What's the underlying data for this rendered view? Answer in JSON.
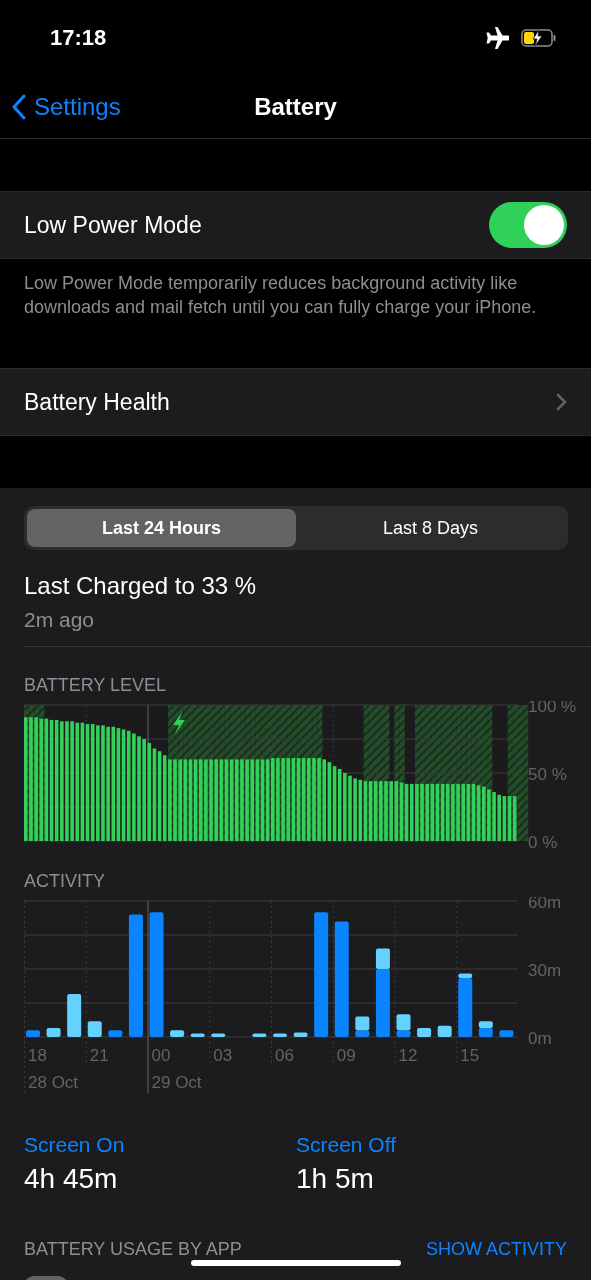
{
  "status_bar": {
    "time": "17:18",
    "airplane_mode": true,
    "charging": true
  },
  "nav": {
    "back": "Settings",
    "title": "Battery"
  },
  "low_power": {
    "label": "Low Power Mode",
    "on": true,
    "footer": "Low Power Mode temporarily reduces background activity like downloads and mail fetch until you can fully charge your iPhone."
  },
  "battery_health": {
    "label": "Battery Health"
  },
  "range_tabs": [
    {
      "label": "Last 24 Hours",
      "selected": true
    },
    {
      "label": "Last 8 Days",
      "selected": false
    }
  ],
  "last_charged": {
    "title": "Last Charged to 33 %",
    "time": "2m ago"
  },
  "battery_level": {
    "label": "BATTERY LEVEL",
    "chart_data": {
      "type": "bar",
      "ylim": [
        0,
        100
      ],
      "yticks": [
        {
          "value": 0,
          "label": "0 %"
        },
        {
          "value": 50,
          "label": "50 %"
        },
        {
          "value": 100,
          "label": "100 %"
        }
      ],
      "values": [
        91,
        91,
        91,
        90,
        90,
        89,
        89,
        88,
        88,
        88,
        87,
        87,
        86,
        86,
        85,
        85,
        84,
        84,
        83,
        82,
        81,
        79,
        77,
        75,
        72,
        68,
        66,
        63,
        60,
        60,
        60,
        60,
        60,
        60,
        60,
        60,
        60,
        60,
        60,
        60,
        60,
        60,
        60,
        60,
        60,
        60,
        60,
        60,
        61,
        61,
        61,
        61,
        61,
        61,
        61,
        61,
        61,
        61,
        60,
        58,
        55,
        53,
        50,
        48,
        46,
        45,
        44,
        44,
        44,
        44,
        44,
        44,
        44,
        43,
        42,
        42,
        42,
        42,
        42,
        42,
        42,
        42,
        42,
        42,
        42,
        42,
        42,
        42,
        41,
        40,
        38,
        36,
        34,
        33,
        33,
        33
      ]
    },
    "charging": [
      true,
      true,
      true,
      true,
      false,
      false,
      false,
      false,
      false,
      false,
      false,
      false,
      false,
      false,
      false,
      false,
      false,
      false,
      false,
      false,
      false,
      false,
      false,
      false,
      false,
      false,
      false,
      false,
      true,
      true,
      true,
      true,
      true,
      true,
      true,
      true,
      true,
      true,
      true,
      true,
      true,
      true,
      true,
      true,
      true,
      true,
      true,
      true,
      true,
      true,
      true,
      true,
      true,
      true,
      true,
      true,
      true,
      true,
      false,
      false,
      false,
      false,
      false,
      false,
      false,
      false,
      true,
      true,
      true,
      true,
      true,
      false,
      true,
      true,
      false,
      false,
      true,
      true,
      true,
      true,
      true,
      true,
      true,
      true,
      true,
      true,
      true,
      true,
      true,
      true,
      true,
      false,
      false,
      false,
      true,
      true,
      true,
      true
    ]
  },
  "activity": {
    "label": "ACTIVITY",
    "dates": [
      "28 Oct",
      "29 Oct"
    ],
    "chart_data": {
      "type": "bar",
      "stacked": true,
      "ylim": [
        0,
        60
      ],
      "categories": [
        "18",
        null,
        null,
        "21",
        null,
        null,
        "00",
        null,
        null,
        "03",
        null,
        null,
        "06",
        null,
        null,
        "09",
        null,
        null,
        "12",
        null,
        null,
        "15",
        null,
        null
      ],
      "yticks": [
        {
          "value": 0,
          "label": "0m"
        },
        {
          "value": 30,
          "label": "30m"
        },
        {
          "value": 60,
          "label": "60m"
        }
      ],
      "series": [
        {
          "name": "Screen On",
          "color": "#0a84ff",
          "values": [
            3,
            0,
            0,
            0,
            3,
            54,
            55,
            0,
            0,
            0,
            0,
            0,
            0,
            0,
            55,
            51,
            3,
            30,
            3,
            0,
            0,
            26,
            4,
            3
          ]
        },
        {
          "name": "Screen Off",
          "color": "#64d2ff",
          "values": [
            0,
            4,
            19,
            7,
            0,
            0,
            0,
            3,
            1.5,
            1.5,
            0,
            1.5,
            1.5,
            2,
            0,
            0,
            6,
            9,
            7,
            4,
            5,
            2,
            3,
            0
          ]
        }
      ]
    }
  },
  "screen_time": [
    {
      "value": "4h 45m"
    },
    {
      "value": "1h 5m"
    }
  ],
  "usage": {
    "label": "BATTERY USAGE BY APP",
    "action": "SHOW ACTIVITY"
  }
}
